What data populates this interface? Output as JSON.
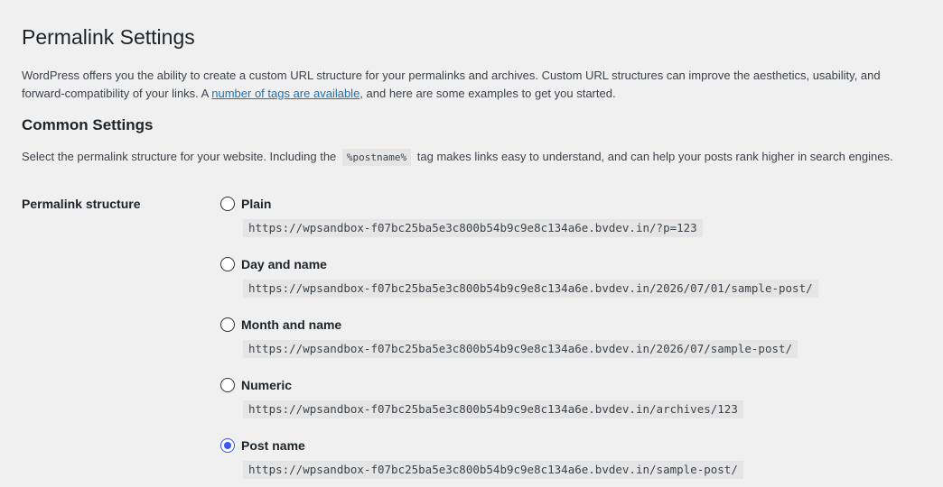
{
  "page": {
    "title": "Permalink Settings",
    "intro_before_link": "WordPress offers you the ability to create a custom URL structure for your permalinks and archives. Custom URL structures can improve the aesthetics, usability, and forward-compatibility of your links. A ",
    "intro_link": "number of tags are available",
    "intro_after_link": ", and here are some examples to get you started."
  },
  "common": {
    "heading": "Common Settings",
    "desc_before_tag": "Select the permalink structure for your website. Including the",
    "tag": "%postname%",
    "desc_after_tag": "tag makes links easy to understand, and can help your posts rank higher in search engines."
  },
  "structure": {
    "label": "Permalink structure",
    "options": [
      {
        "label": "Plain",
        "url": "https://wpsandbox-f07bc25ba5e3c800b54b9c9e8c134a6e.bvdev.in/?p=123",
        "checked": false
      },
      {
        "label": "Day and name",
        "url": "https://wpsandbox-f07bc25ba5e3c800b54b9c9e8c134a6e.bvdev.in/2026/07/01/sample-post/",
        "checked": false
      },
      {
        "label": "Month and name",
        "url": "https://wpsandbox-f07bc25ba5e3c800b54b9c9e8c134a6e.bvdev.in/2026/07/sample-post/",
        "checked": false
      },
      {
        "label": "Numeric",
        "url": "https://wpsandbox-f07bc25ba5e3c800b54b9c9e8c134a6e.bvdev.in/archives/123",
        "checked": false
      },
      {
        "label": "Post name",
        "url": "https://wpsandbox-f07bc25ba5e3c800b54b9c9e8c134a6e.bvdev.in/sample-post/",
        "checked": true
      }
    ]
  },
  "colors": {
    "link": "#2271b1",
    "radio_checked": "#3858e9",
    "background": "#f0f0f1",
    "code_background": "#e5e5e5"
  }
}
